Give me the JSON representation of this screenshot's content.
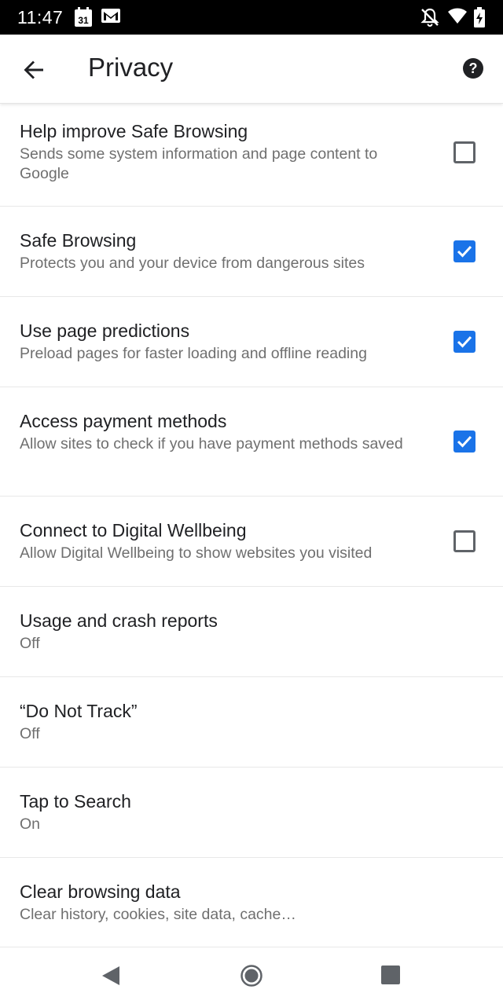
{
  "status_bar": {
    "time": "11:47",
    "calendar_day": "31",
    "icons": [
      "calendar-icon",
      "gmail-icon",
      "notifications-off-icon",
      "wifi-icon",
      "battery-charging-icon"
    ]
  },
  "app_bar": {
    "title": "Privacy",
    "back_icon": "arrow-back-icon",
    "help_icon": "help-icon"
  },
  "settings": [
    {
      "title": "Help improve Safe Browsing",
      "summary": "Sends some system information and page content to Google",
      "checkbox": true,
      "checked": false
    },
    {
      "title": "Safe Browsing",
      "summary": "Protects you and your device from dangerous sites",
      "checkbox": true,
      "checked": true
    },
    {
      "title": "Use page predictions",
      "summary": "Preload pages for faster loading and offline reading",
      "checkbox": true,
      "checked": true
    },
    {
      "title": "Access payment methods",
      "summary": "Allow sites to check if you have payment methods saved",
      "checkbox": true,
      "checked": true
    },
    {
      "title": "Connect to Digital Wellbeing",
      "summary": "Allow Digital Wellbeing to show websites you visited",
      "checkbox": true,
      "checked": false
    },
    {
      "title": "Usage and crash reports",
      "summary": "Off",
      "checkbox": false
    },
    {
      "title": "“Do Not Track”",
      "summary": "Off",
      "checkbox": false
    },
    {
      "title": "Tap to Search",
      "summary": "On",
      "checkbox": false
    },
    {
      "title": "Clear browsing data",
      "summary": "Clear history, cookies, site data, cache…",
      "checkbox": false
    }
  ],
  "nav_bar": {
    "icons": [
      "nav-back-icon",
      "nav-home-icon",
      "nav-recents-icon"
    ]
  },
  "colors": {
    "accent": "#1a73e8",
    "status_bar": "#000000",
    "text_primary": "#202124",
    "text_secondary": "#6f6f6f"
  }
}
